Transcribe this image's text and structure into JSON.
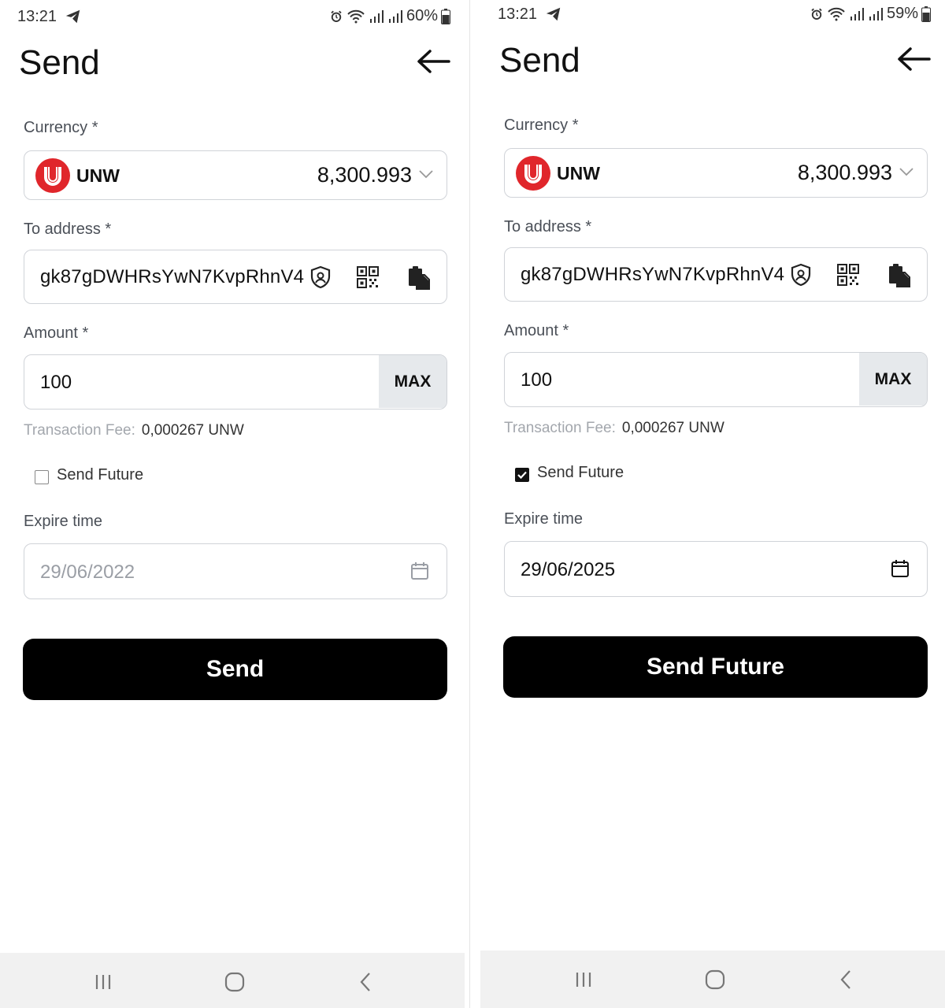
{
  "screens": [
    {
      "status": {
        "time": "13:21",
        "battery": "60%"
      },
      "title": "Send",
      "currency_label": "Currency *",
      "currency_code": "UNW",
      "currency_balance": "8,300.993",
      "address_label": "To address *",
      "address_value": "gk87gDWHRsYwN7KvpRhnV4",
      "amount_label": "Amount *",
      "amount_value": "100",
      "max_label": "MAX",
      "fee_label": "Transaction Fee:",
      "fee_value": "0,000267 UNW",
      "send_future_checked": false,
      "send_future_label": "Send Future",
      "expire_label": "Expire time",
      "expire_value": "29/06/2022",
      "button_label": "Send"
    },
    {
      "status": {
        "time": "13:21",
        "battery": "59%"
      },
      "title": "Send",
      "currency_label": "Currency *",
      "currency_code": "UNW",
      "currency_balance": "8,300.993",
      "address_label": "To address *",
      "address_value": "gk87gDWHRsYwN7KvpRhnV4",
      "amount_label": "Amount *",
      "amount_value": "100",
      "max_label": "MAX",
      "fee_label": "Transaction Fee:",
      "fee_value": "0,000267 UNW",
      "send_future_checked": true,
      "send_future_label": "Send Future",
      "expire_label": "Expire time",
      "expire_value": "29/06/2025",
      "button_label": "Send Future"
    }
  ],
  "colors": {
    "brand_red": "#e0262b",
    "button_bg": "#000000",
    "max_bg": "#e6e9ec",
    "field_border": "#d0d3d8"
  },
  "icons": [
    "telegram-icon",
    "alarm-icon",
    "wifi-icon",
    "signal-icon",
    "battery-icon",
    "back-arrow-icon",
    "unw-logo-icon",
    "chevron-down-icon",
    "shield-user-icon",
    "qr-code-icon",
    "paste-icon",
    "calendar-icon",
    "recents-icon",
    "home-icon",
    "nav-back-icon"
  ]
}
